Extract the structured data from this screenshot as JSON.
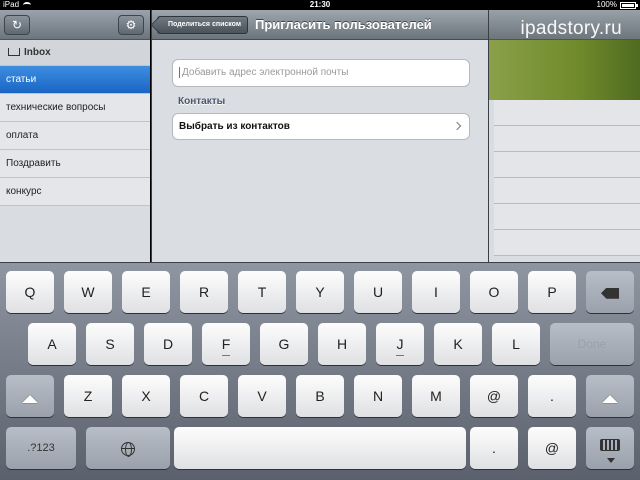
{
  "status_bar": {
    "device": "iPad",
    "time": "21:30",
    "battery": "100%",
    "battery_level": 1.0
  },
  "watermark": "ipadstory.ru",
  "left_pane": {
    "items": [
      {
        "label": "Inbox"
      },
      {
        "label": "статьи"
      },
      {
        "label": "технические вопросы"
      },
      {
        "label": "оплата"
      },
      {
        "label": "Поздравить"
      },
      {
        "label": "конкурс"
      }
    ],
    "selected": "статьи"
  },
  "modal": {
    "back_label": "Поделиться списком",
    "title": "Пригласить пользователей",
    "email_placeholder": "Добавить адрес электронной почты",
    "section_header": "Контакты",
    "choose_contacts": "Выбрать из контактов"
  },
  "keyboard": {
    "row1": [
      "Q",
      "W",
      "E",
      "R",
      "T",
      "Y",
      "U",
      "I",
      "O",
      "P"
    ],
    "row2": [
      "A",
      "S",
      "D",
      "F",
      "G",
      "H",
      "J",
      "K",
      "L"
    ],
    "row3": [
      "Z",
      "X",
      "C",
      "V",
      "B",
      "N",
      "M",
      "@",
      "."
    ],
    "done_label": "Done",
    "numbers_label": ".?123"
  },
  "colors": {
    "selection": "#1a66c4",
    "keyboard_bg": "#5a616d"
  }
}
